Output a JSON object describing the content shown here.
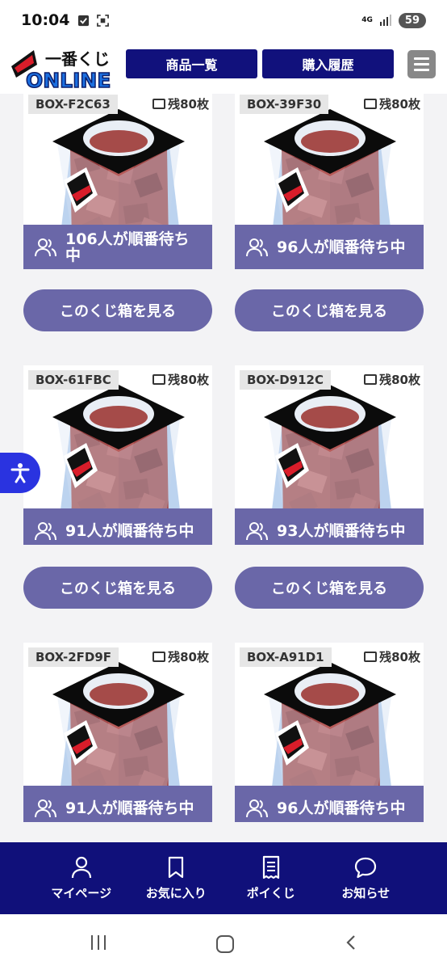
{
  "status": {
    "time": "10:04",
    "network": "4G",
    "battery": "59"
  },
  "header": {
    "logo_top": "一番くじ",
    "logo_bottom": "ONLINE",
    "nav_products": "商品一覧",
    "nav_history": "購入履歴"
  },
  "colors": {
    "navy": "#10107a",
    "purple": "#6a67a8",
    "a11y": "#2a33e0"
  },
  "boxes": [
    {
      "id": "BOX-F2C63",
      "remain": "残80枚",
      "waiting": "106人が順番待ち中",
      "button": "このくじ箱を見る"
    },
    {
      "id": "BOX-39F30",
      "remain": "残80枚",
      "waiting": "96人が順番待ち中",
      "button": "このくじ箱を見る"
    },
    {
      "id": "BOX-61FBC",
      "remain": "残80枚",
      "waiting": "91人が順番待ち中",
      "button": "このくじ箱を見る"
    },
    {
      "id": "BOX-D912C",
      "remain": "残80枚",
      "waiting": "93人が順番待ち中",
      "button": "このくじ箱を見る"
    },
    {
      "id": "BOX-2FD9F",
      "remain": "残80枚",
      "waiting": "91人が順番待ち中"
    },
    {
      "id": "BOX-A91D1",
      "remain": "残80枚",
      "waiting": "96人が順番待ち中"
    }
  ],
  "bottom_nav": [
    {
      "label": "マイページ",
      "icon": "user-icon"
    },
    {
      "label": "お気に入り",
      "icon": "bookmark-icon"
    },
    {
      "label": "ポイくじ",
      "icon": "receipt-icon"
    },
    {
      "label": "お知らせ",
      "icon": "chat-bubble-icon"
    }
  ]
}
